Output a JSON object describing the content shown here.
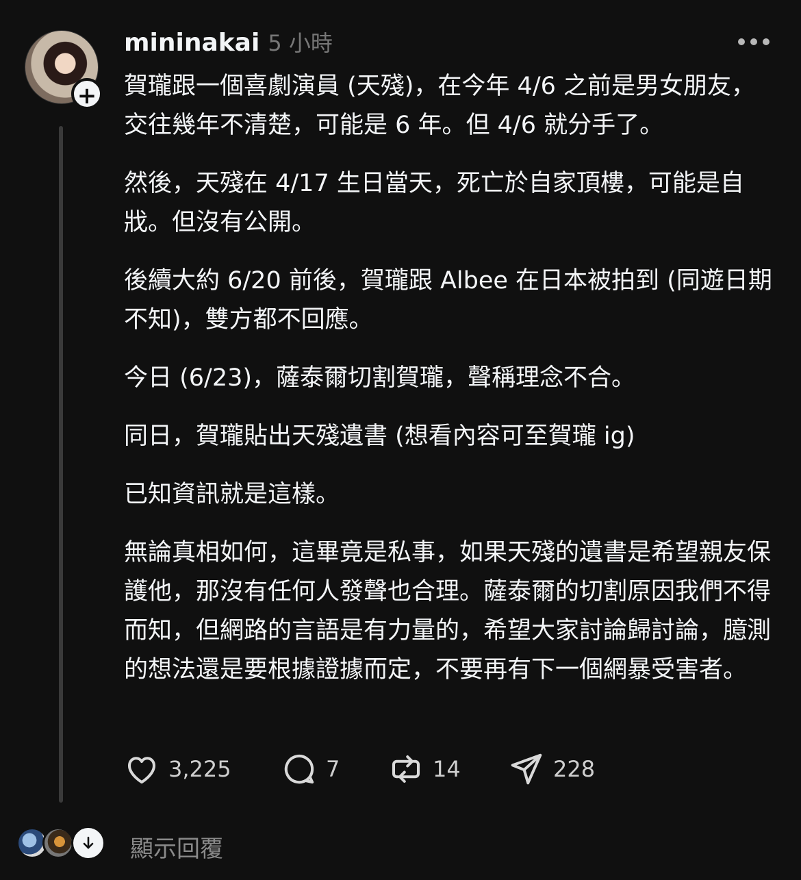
{
  "post": {
    "username": "mininakai",
    "timestamp": "5 小時",
    "paragraphs": [
      "賀瓏跟一個喜劇演員 (天殘)，在今年 4/6 之前是男女朋友，交往幾年不清楚，可能是 6 年。但 4/6 就分手了。",
      "然後，天殘在 4/17 生日當天，死亡於自家頂樓，可能是自戕。但沒有公開。",
      "後續大約 6/20 前後，賀瓏跟 Albee 在日本被拍到 (同遊日期不知)，雙方都不回應。",
      "今日 (6/23)，薩泰爾切割賀瓏，聲稱理念不合。",
      "同日，賀瓏貼出天殘遺書 (想看內容可至賀瓏 ig)",
      "已知資訊就是這樣。",
      "無論真相如何，這畢竟是私事，如果天殘的遺書是希望親友保護他，那沒有任何人發聲也合理。薩泰爾的切割原因我們不得而知，但網路的言語是有力量的，希望大家討論歸討論，臆測的想法還是要根據證據而定，不要再有下一個網暴受害者。"
    ]
  },
  "actions": {
    "likes": "3,225",
    "comments": "7",
    "reposts": "14",
    "shares": "228"
  },
  "replies": {
    "label": "顯示回覆"
  },
  "icons": {
    "follow": "plus-icon",
    "more": "more-icon",
    "like": "heart-icon",
    "comment": "comment-icon",
    "repost": "repost-icon",
    "share": "send-icon",
    "expand": "arrow-down-icon"
  },
  "colors": {
    "background": "#101010",
    "text": "#f3f5f7",
    "muted": "#777777",
    "thread_line": "#3a3a3a"
  }
}
